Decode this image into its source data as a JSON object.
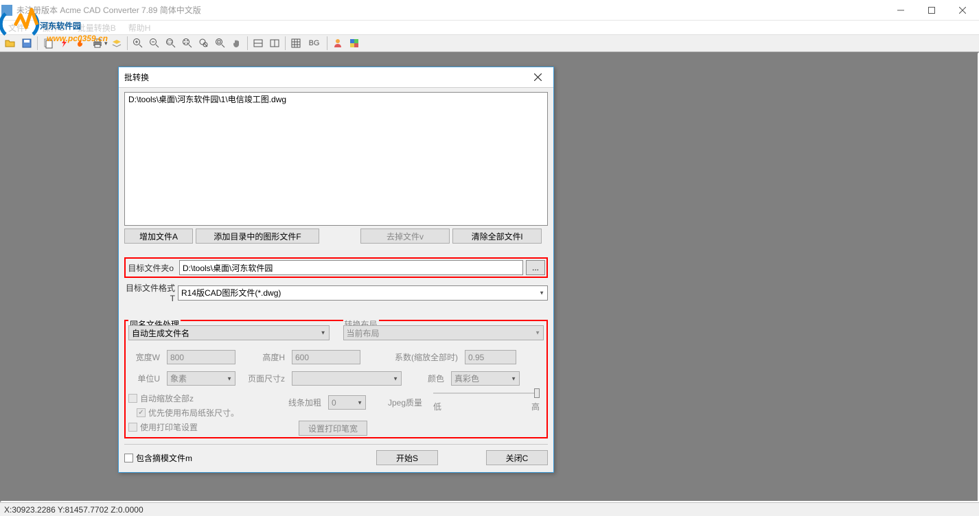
{
  "window": {
    "title": "未注册版本 Acme CAD Converter 7.89 简体中文版"
  },
  "menubar": {
    "items": [
      "文件F",
      "操作O",
      "批量转换B",
      "帮助H"
    ]
  },
  "toolbar": {
    "bg_label": "BG"
  },
  "dialog": {
    "title": "批转换",
    "file_item": "D:\\tools\\桌面\\河东软件园\\1\\电信竣工图.dwg",
    "btn_add_file": "增加文件A",
    "btn_add_dir": "添加目录中的图形文件F",
    "btn_remove": "去掉文件v",
    "btn_clear_all": "清除全部文件l",
    "target_folder_label": "目标文件夹o",
    "target_folder_value": "D:\\tools\\桌面\\河东软件园",
    "browse": "...",
    "target_format_label": "目标文件格式T",
    "target_format_value": "R14版CAD图形文件(*.dwg)",
    "dup_group": "同名文件处理",
    "dup_value": "自动生成文件名",
    "layout_group": "转换布局",
    "layout_value": "当前布局",
    "width_label": "宽度W",
    "width_value": "800",
    "height_label": "高度H",
    "height_value": "600",
    "scale_label": "系数(缩放全部时)",
    "scale_value": "0.95",
    "unit_label": "单位U",
    "unit_value": "象素",
    "page_label": "页面尺寸z",
    "color_label": "颜色",
    "color_value": "真彩色",
    "chk_auto_scale": "自动缩放全部z",
    "chk_use_layout_paper": "优先使用布局纸张尺寸。",
    "chk_use_pen": "使用打印笔设置",
    "line_weight_label": "线条加粗",
    "line_weight_value": "0",
    "btn_pen_settings": "设置打印笔宽",
    "jpeg_label": "Jpeg质量",
    "jpeg_low": "低",
    "jpeg_high": "高",
    "chk_include_model": "包含摘模文件m",
    "btn_start": "开始S",
    "btn_close": "关闭C"
  },
  "statusbar": {
    "coords": "X:30923.2286 Y:81457.7702 Z:0.0000"
  },
  "watermark": {
    "text1": "河东软件园",
    "text2": "www.pc0359.cn"
  }
}
